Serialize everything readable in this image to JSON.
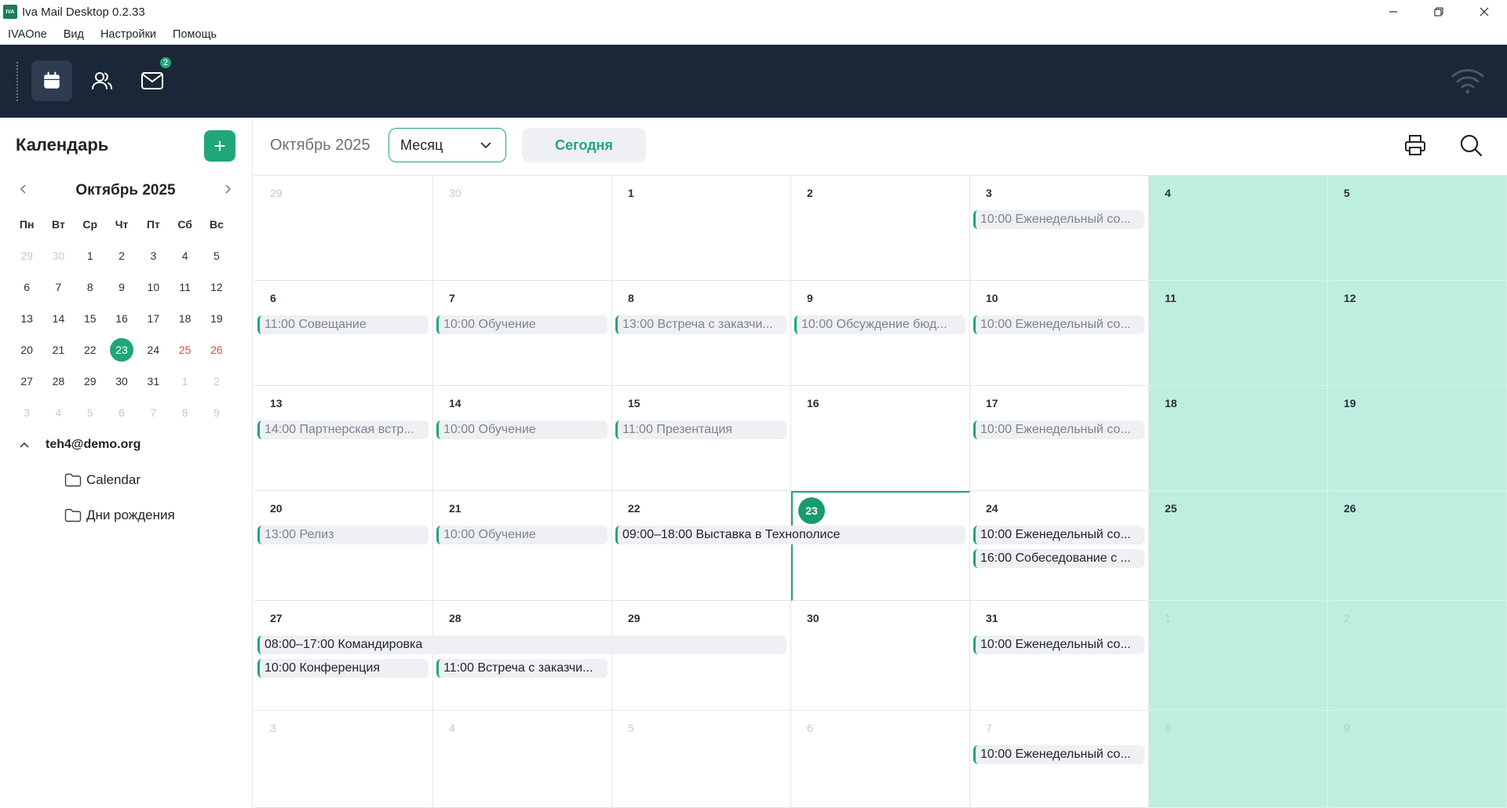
{
  "window": {
    "title": "Iva Mail Desktop 0.2.33",
    "logo": "IVA"
  },
  "menu": [
    "IVAOne",
    "Вид",
    "Настройки",
    "Помощь"
  ],
  "toolbar": {
    "mail_badge": "2"
  },
  "sidebar": {
    "title": "Календарь",
    "add_label": "+",
    "mini_title": "Октябрь 2025",
    "weekdays": [
      "Пн",
      "Вт",
      "Ср",
      "Чт",
      "Пт",
      "Сб",
      "Вс"
    ],
    "account": "teh4@demo.org",
    "folders": [
      "Calendar",
      "Дни рождения"
    ]
  },
  "header": {
    "month": "Октябрь 2025",
    "view": "Месяц",
    "today": "Сегодня"
  },
  "mini_calendar": [
    [
      {
        "d": "29",
        "m": 1
      },
      {
        "d": "30",
        "m": 1
      },
      {
        "d": "1"
      },
      {
        "d": "2"
      },
      {
        "d": "3"
      },
      {
        "d": "4"
      },
      {
        "d": "5"
      }
    ],
    [
      {
        "d": "6"
      },
      {
        "d": "7"
      },
      {
        "d": "8"
      },
      {
        "d": "9"
      },
      {
        "d": "10"
      },
      {
        "d": "11"
      },
      {
        "d": "12"
      }
    ],
    [
      {
        "d": "13"
      },
      {
        "d": "14"
      },
      {
        "d": "15"
      },
      {
        "d": "16"
      },
      {
        "d": "17"
      },
      {
        "d": "18"
      },
      {
        "d": "19"
      }
    ],
    [
      {
        "d": "20"
      },
      {
        "d": "21"
      },
      {
        "d": "22"
      },
      {
        "d": "23",
        "t": 1
      },
      {
        "d": "24"
      },
      {
        "d": "25",
        "w": 1
      },
      {
        "d": "26",
        "w": 1
      }
    ],
    [
      {
        "d": "27"
      },
      {
        "d": "28"
      },
      {
        "d": "29"
      },
      {
        "d": "30"
      },
      {
        "d": "31"
      },
      {
        "d": "1",
        "m": 1
      },
      {
        "d": "2",
        "m": 1
      }
    ],
    [
      {
        "d": "3",
        "m": 1
      },
      {
        "d": "4",
        "m": 1
      },
      {
        "d": "5",
        "m": 1
      },
      {
        "d": "6",
        "m": 1
      },
      {
        "d": "7",
        "m": 1
      },
      {
        "d": "8",
        "m": 1
      },
      {
        "d": "9",
        "m": 1
      }
    ]
  ],
  "month_grid": [
    [
      {
        "d": "29",
        "m": 1
      },
      {
        "d": "30",
        "m": 1
      },
      {
        "d": "1"
      },
      {
        "d": "2"
      },
      {
        "d": "3"
      },
      {
        "d": "4"
      },
      {
        "d": "5"
      }
    ],
    [
      {
        "d": "6"
      },
      {
        "d": "7"
      },
      {
        "d": "8"
      },
      {
        "d": "9"
      },
      {
        "d": "10"
      },
      {
        "d": "11"
      },
      {
        "d": "12"
      }
    ],
    [
      {
        "d": "13"
      },
      {
        "d": "14"
      },
      {
        "d": "15"
      },
      {
        "d": "16"
      },
      {
        "d": "17"
      },
      {
        "d": "18"
      },
      {
        "d": "19"
      }
    ],
    [
      {
        "d": "20"
      },
      {
        "d": "21"
      },
      {
        "d": "22"
      },
      {
        "d": "23",
        "t": 1
      },
      {
        "d": "24"
      },
      {
        "d": "25"
      },
      {
        "d": "26"
      }
    ],
    [
      {
        "d": "27"
      },
      {
        "d": "28"
      },
      {
        "d": "29"
      },
      {
        "d": "30"
      },
      {
        "d": "31"
      },
      {
        "d": "1",
        "m": 1
      },
      {
        "d": "2",
        "m": 1
      }
    ],
    [
      {
        "d": "3",
        "m": 1
      },
      {
        "d": "4",
        "m": 1
      },
      {
        "d": "5",
        "m": 1
      },
      {
        "d": "6",
        "m": 1
      },
      {
        "d": "7",
        "m": 1
      },
      {
        "d": "8",
        "m": 1
      },
      {
        "d": "9",
        "m": 1
      }
    ]
  ],
  "events": [
    {
      "row": 0,
      "col": 4,
      "span": 1,
      "slot": 0,
      "time": "10:00",
      "title": "Еженедельный со...",
      "past": true
    },
    {
      "row": 1,
      "col": 0,
      "span": 1,
      "slot": 0,
      "time": "11:00",
      "title": "Совещание",
      "past": true
    },
    {
      "row": 1,
      "col": 1,
      "span": 1,
      "slot": 0,
      "time": "10:00",
      "title": "Обучение",
      "past": true
    },
    {
      "row": 1,
      "col": 2,
      "span": 1,
      "slot": 0,
      "time": "13:00",
      "title": "Встреча с заказчи...",
      "past": true
    },
    {
      "row": 1,
      "col": 3,
      "span": 1,
      "slot": 0,
      "time": "10:00",
      "title": "Обсуждение бюд...",
      "past": true
    },
    {
      "row": 1,
      "col": 4,
      "span": 1,
      "slot": 0,
      "time": "10:00",
      "title": "Еженедельный со...",
      "past": true
    },
    {
      "row": 2,
      "col": 0,
      "span": 1,
      "slot": 0,
      "time": "14:00",
      "title": "Партнерская встр...",
      "past": true
    },
    {
      "row": 2,
      "col": 1,
      "span": 1,
      "slot": 0,
      "time": "10:00",
      "title": "Обучение",
      "past": true
    },
    {
      "row": 2,
      "col": 2,
      "span": 1,
      "slot": 0,
      "time": "11:00",
      "title": "Презентация",
      "past": true
    },
    {
      "row": 2,
      "col": 4,
      "span": 1,
      "slot": 0,
      "time": "10:00",
      "title": "Еженедельный со...",
      "past": true
    },
    {
      "row": 3,
      "col": 0,
      "span": 1,
      "slot": 0,
      "time": "13:00",
      "title": "Релиз",
      "past": true
    },
    {
      "row": 3,
      "col": 1,
      "span": 1,
      "slot": 0,
      "time": "10:00",
      "title": "Обучение",
      "past": true
    },
    {
      "row": 3,
      "col": 2,
      "span": 2,
      "slot": 0,
      "time": "09:00–18:00",
      "title": "Выставка в Технополисе",
      "past": false
    },
    {
      "row": 3,
      "col": 4,
      "span": 1,
      "slot": 0,
      "time": "10:00",
      "title": "Еженедельный со...",
      "past": false
    },
    {
      "row": 3,
      "col": 4,
      "span": 1,
      "slot": 1,
      "time": "16:00",
      "title": "Собеседование с ...",
      "past": false
    },
    {
      "row": 4,
      "col": 0,
      "span": 3,
      "slot": 0,
      "time": "08:00–17:00",
      "title": "Командировка",
      "past": false
    },
    {
      "row": 4,
      "col": 0,
      "span": 1,
      "slot": 1,
      "time": "10:00",
      "title": "Конференция",
      "past": false
    },
    {
      "row": 4,
      "col": 1,
      "span": 1,
      "slot": 1,
      "time": "11:00",
      "title": "Встреча с заказчи...",
      "past": false
    },
    {
      "row": 4,
      "col": 4,
      "span": 1,
      "slot": 0,
      "time": "10:00",
      "title": "Еженедельный со...",
      "past": false
    },
    {
      "row": 5,
      "col": 4,
      "span": 1,
      "slot": 0,
      "time": "10:00",
      "title": "Еженедельный со...",
      "past": false
    }
  ],
  "colors": {
    "accent": "#21a67a",
    "toolbar_bg": "#1a2738",
    "weekend_bg": "#beeee0",
    "event_bg": "#eef0f3",
    "weekend_text": "#e0483e"
  }
}
